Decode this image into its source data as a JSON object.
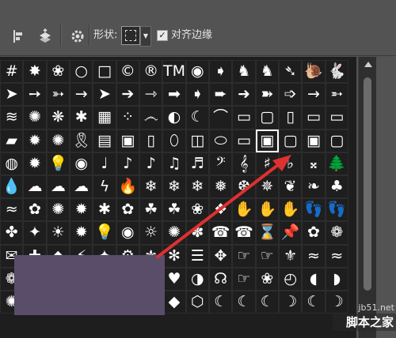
{
  "toolbar": {
    "shape_label": "形状:",
    "align_edges_label": "对齐边缘",
    "align_edges_checked": true
  },
  "shape_grid": {
    "selected_row": 3,
    "selected_col": 11,
    "rows": [
      [
        "#",
        "✸",
        "❀",
        "○",
        "□",
        "©",
        "®",
        "TM",
        "◉",
        "➧",
        "♞",
        "♞",
        "➴",
        "🐌",
        "🐇"
      ],
      [
        "➤",
        "➙",
        "➳",
        "→",
        "➤",
        "➔",
        "⇾",
        "➡",
        "➧",
        "➨",
        "➜",
        "➽",
        "➩",
        "→",
        "➵"
      ],
      [
        "≋",
        "✺",
        "❋",
        "✱",
        "▦",
        "⁘",
        "෴",
        "◐",
        "☾",
        "⌒",
        "▭",
        "▢",
        "▯",
        "▭",
        "▭"
      ],
      [
        "▰",
        "✹",
        "✺",
        "🎗",
        "▤",
        "▣",
        "▯",
        "⬯",
        "◫",
        "⬭",
        "▭",
        "▣",
        "▢",
        "▣",
        "▢"
      ],
      [
        "◍",
        "✹",
        "💡",
        "◉",
        "♩",
        "♪",
        "♪",
        "♫",
        "♬",
        "𝄢",
        "𝄞",
        "♯",
        "♭",
        "𝄪",
        "🌲"
      ],
      [
        "💧",
        "☁",
        "☁",
        "☁",
        "ϟ",
        "🔥",
        "❄",
        "❄",
        "❄",
        "❅",
        "❆",
        "✵",
        "❦",
        "❧",
        "♣"
      ],
      [
        "≈",
        "✿",
        "✺",
        "✹",
        "✱",
        "✿",
        "☘",
        "☘",
        "❀",
        "❖",
        "✋",
        "✋",
        "✋",
        "👣",
        "👣"
      ],
      [
        "✤",
        "✦",
        "☀",
        "✹",
        "💡",
        "◉",
        "☼",
        "✺",
        "✽",
        "☎",
        "☎",
        "⌛",
        "📌",
        "✿",
        "❁"
      ],
      [
        "✉",
        "✚",
        "◆",
        "⚡",
        "✦",
        "⚙",
        "⚜",
        "✻",
        "☰",
        "✥",
        "☞",
        "☞",
        "⚜",
        "≈",
        "≈"
      ],
      [
        "❁",
        "❁",
        "⎈",
        "❦",
        "❁",
        "✿",
        "❀",
        "♥",
        "◑",
        "☊",
        "☞",
        "❀",
        "◴",
        "◖",
        "◗"
      ],
      [
        "✺",
        "✹",
        "⬢",
        "♣",
        "♥",
        "♠",
        "♦",
        "◆",
        "⬡",
        "☾",
        "☾",
        "☾",
        "☽",
        "☾",
        "☽"
      ]
    ]
  },
  "watermark": {
    "site": "jb51.net",
    "name": "脚本之家"
  }
}
